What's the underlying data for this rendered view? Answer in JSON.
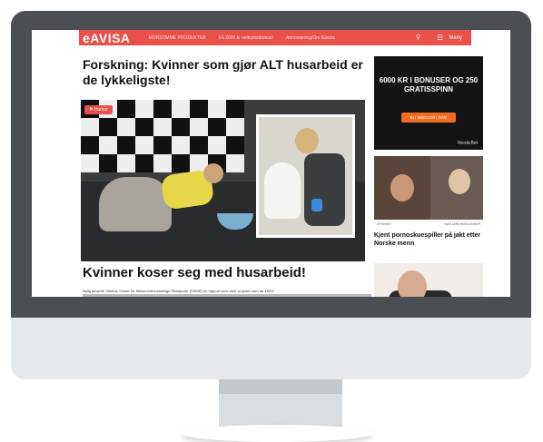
{
  "site": {
    "logo": "eAVISA",
    "nav": [
      "MORSOMME PRODUKTER",
      "Få 2000 kr velkomstbonus!",
      "Annonsering/Om Eavisa"
    ],
    "menu_label": "Meny"
  },
  "article": {
    "title": "Forskning: Kvinner som gjør ALT husarbeid er de lykkeligste!",
    "tag": "Humor",
    "subtitle": "Kvinner koser seg med husarbeid!",
    "intro": "Nylig lanserte Statens Senter for Mellommenneskelige Relasjoner (SSMR) en rapport som viser at jenter som tar 100%"
  },
  "sidebar": {
    "ad": {
      "text": "6000 KR I BONUSER OG 250 GRATISSPINN",
      "button": "BLI MEDLEM I DAG",
      "brand": "NordicBet"
    },
    "story1": {
      "caption_left": "SPONSET",
      "caption_right": "NØS ANNONSELENKER",
      "title": "Kjent pornoskuespiller på jakt etter Norske menn"
    }
  },
  "colors": {
    "brand_red": "#e9504a",
    "monitor_bezel": "#4b4f54",
    "monitor_chin": "#e5e9ec"
  }
}
